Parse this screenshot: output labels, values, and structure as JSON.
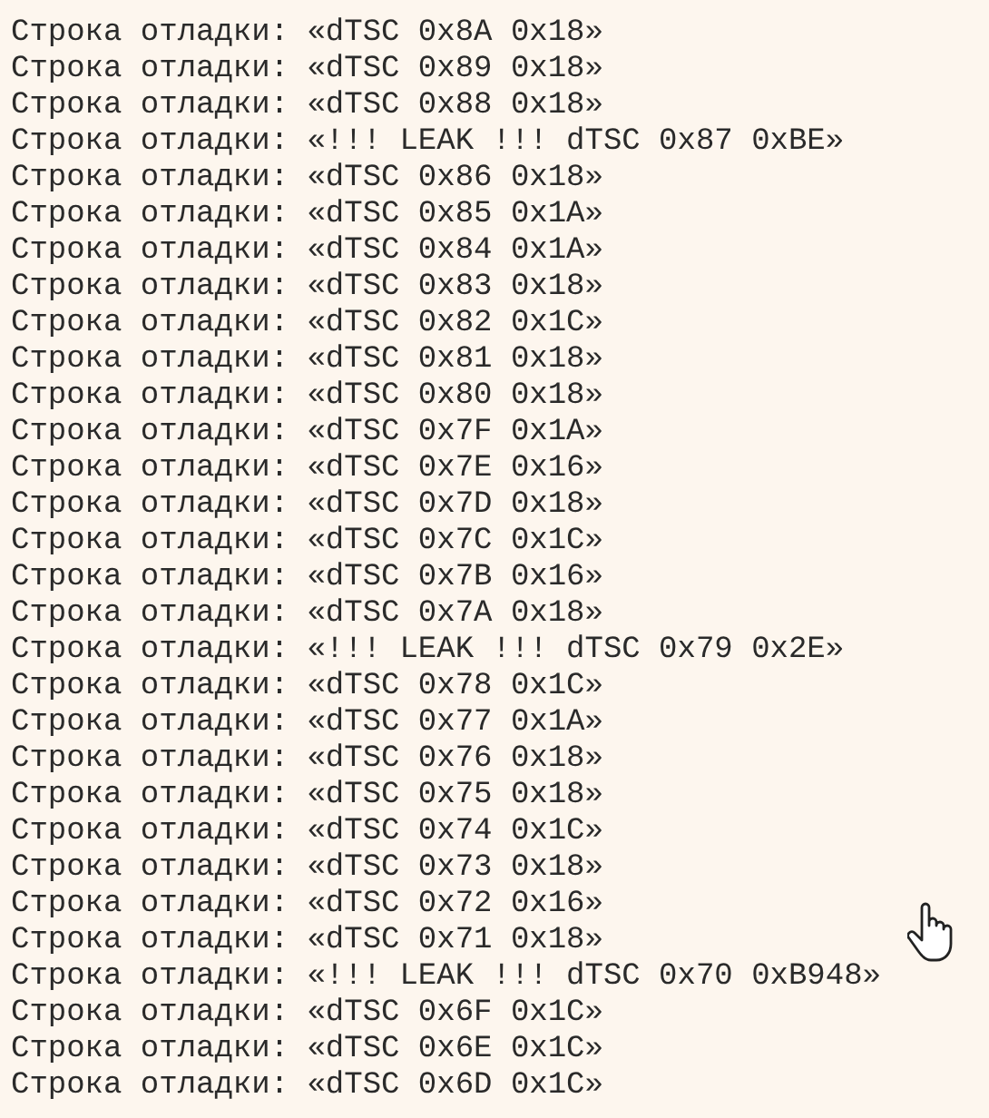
{
  "log_lines": [
    "Строка отладки: «dTSC 0x8A 0x18»",
    "Строка отладки: «dTSC 0x89 0x18»",
    "Строка отладки: «dTSC 0x88 0x18»",
    "Строка отладки: «!!! LEAK !!! dTSC 0x87 0xBE»",
    "Строка отладки: «dTSC 0x86 0x18»",
    "Строка отладки: «dTSC 0x85 0x1A»",
    "Строка отладки: «dTSC 0x84 0x1A»",
    "Строка отладки: «dTSC 0x83 0x18»",
    "Строка отладки: «dTSC 0x82 0x1C»",
    "Строка отладки: «dTSC 0x81 0x18»",
    "Строка отладки: «dTSC 0x80 0x18»",
    "Строка отладки: «dTSC 0x7F 0x1A»",
    "Строка отладки: «dTSC 0x7E 0x16»",
    "Строка отладки: «dTSC 0x7D 0x18»",
    "Строка отладки: «dTSC 0x7C 0x1C»",
    "Строка отладки: «dTSC 0x7B 0x16»",
    "Строка отладки: «dTSC 0x7A 0x18»",
    "Строка отладки: «!!! LEAK !!! dTSC 0x79 0x2E»",
    "Строка отладки: «dTSC 0x78 0x1C»",
    "Строка отладки: «dTSC 0x77 0x1A»",
    "Строка отладки: «dTSC 0x76 0x18»",
    "Строка отладки: «dTSC 0x75 0x18»",
    "Строка отладки: «dTSC 0x74 0x1C»",
    "Строка отладки: «dTSC 0x73 0x18»",
    "Строка отладки: «dTSC 0x72 0x16»",
    "Строка отладки: «dTSC 0x71 0x18»",
    "Строка отладки: «!!! LEAK !!! dTSC 0x70 0xB948»",
    "Строка отладки: «dTSC 0x6F 0x1C»",
    "Строка отладки: «dTSC 0x6E 0x1C»",
    "Строка отладки: «dTSC 0x6D 0x1C»"
  ]
}
